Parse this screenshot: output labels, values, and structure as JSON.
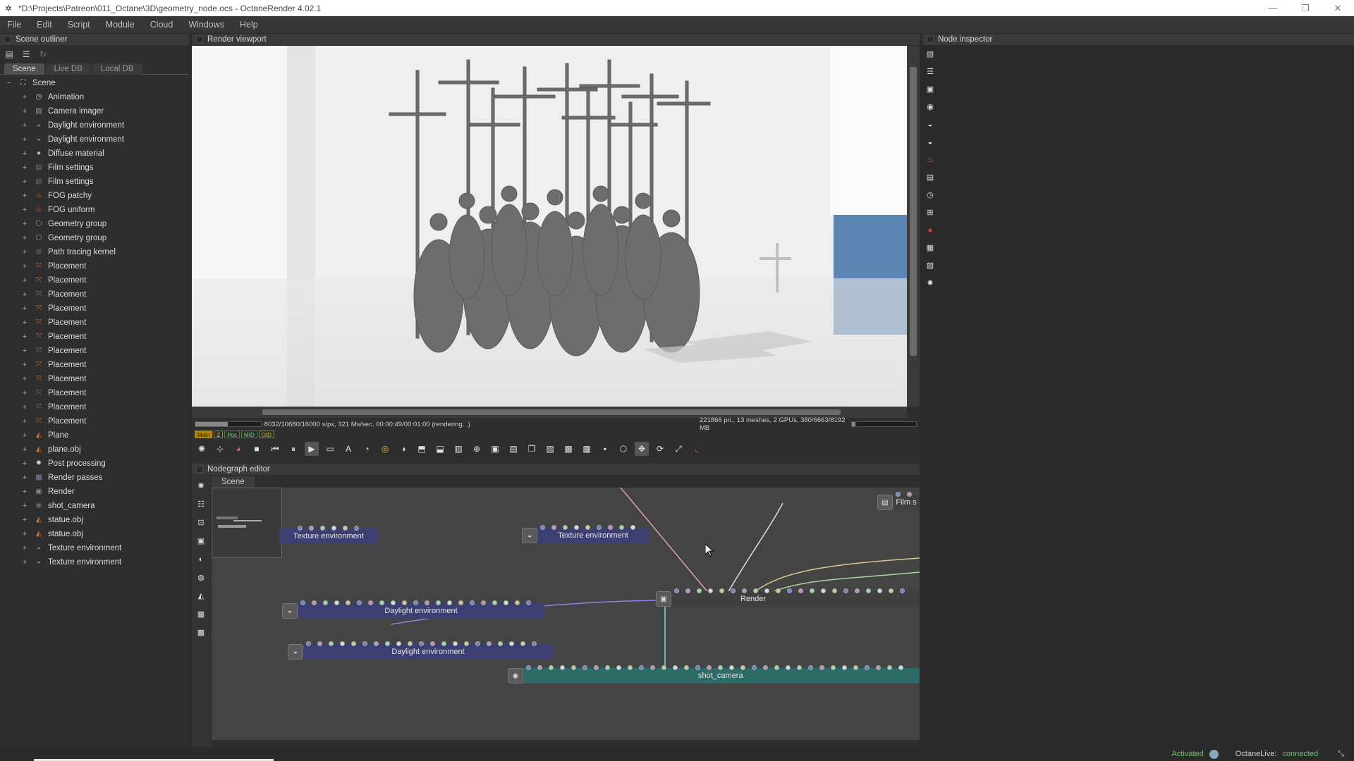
{
  "window": {
    "title": "*D:\\Projects\\Patreon\\011_Octane\\3D\\geometry_node.ocs - OctaneRender 4.02.1",
    "minimize": "—",
    "restore": "❐",
    "close": "✕"
  },
  "menu": [
    "File",
    "Edit",
    "Script",
    "Module",
    "Cloud",
    "Windows",
    "Help"
  ],
  "outliner": {
    "header": "Scene outliner",
    "tabs": [
      "Scene",
      "Live DB",
      "Local DB"
    ],
    "root": "Scene",
    "items": [
      {
        "label": "Animation",
        "icon": "clock-icon",
        "color": "#cfcfcf"
      },
      {
        "label": "Camera imager",
        "icon": "imager-icon",
        "color": "#9a9a9a"
      },
      {
        "label": "Daylight environment",
        "icon": "environment-icon",
        "color": "#8a8a8a"
      },
      {
        "label": "Daylight environment",
        "icon": "environment-icon",
        "color": "#8a8a8a"
      },
      {
        "label": "Diffuse material",
        "icon": "material-sphere-icon",
        "color": "#bdbdbd"
      },
      {
        "label": "Film settings",
        "icon": "film-icon",
        "color": "#707070"
      },
      {
        "label": "Film settings",
        "icon": "film-icon",
        "color": "#707070"
      },
      {
        "label": "FOG patchy",
        "icon": "flame-icon",
        "color": "#e08a2a"
      },
      {
        "label": "FOG uniform",
        "icon": "flame-icon",
        "color": "#e08a2a"
      },
      {
        "label": "Geometry group",
        "icon": "geometry-icon",
        "color": "#9a9a9a"
      },
      {
        "label": "Geometry group",
        "icon": "geometry-icon",
        "color": "#9a9a9a"
      },
      {
        "label": "Path tracing kernel",
        "icon": "kernel-icon",
        "color": "#707070"
      },
      {
        "label": "Placement",
        "icon": "placement-icon",
        "color": "#d07a3a"
      },
      {
        "label": "Placement",
        "icon": "placement-icon",
        "color": "#d07a3a"
      },
      {
        "label": "Placement",
        "icon": "placement-icon",
        "color": "#d07a3a"
      },
      {
        "label": "Placement",
        "icon": "placement-icon",
        "color": "#d07a3a"
      },
      {
        "label": "Placement",
        "icon": "placement-icon",
        "color": "#d07a3a"
      },
      {
        "label": "Placement",
        "icon": "placement-icon",
        "color": "#d07a3a"
      },
      {
        "label": "Placement",
        "icon": "placement-icon",
        "color": "#d07a3a"
      },
      {
        "label": "Placement",
        "icon": "placement-icon",
        "color": "#d07a3a"
      },
      {
        "label": "Placement",
        "icon": "placement-icon",
        "color": "#d07a3a"
      },
      {
        "label": "Placement",
        "icon": "placement-icon",
        "color": "#d07a3a"
      },
      {
        "label": "Placement",
        "icon": "placement-icon",
        "color": "#d07a3a"
      },
      {
        "label": "Placement",
        "icon": "placement-icon",
        "color": "#d07a3a"
      },
      {
        "label": "Plane",
        "icon": "mesh-icon",
        "color": "#d07a3a"
      },
      {
        "label": "plane.obj",
        "icon": "mesh-icon",
        "color": "#d07a3a"
      },
      {
        "label": "Post processing",
        "icon": "post-processing-icon",
        "color": "#cfcfcf"
      },
      {
        "label": "Render passes",
        "icon": "render-passes-icon",
        "color": "#7a8aa8"
      },
      {
        "label": "Render",
        "icon": "render-target-icon",
        "color": "#8a8a8a"
      },
      {
        "label": "shot_camera",
        "icon": "camera-icon",
        "color": "#707070"
      },
      {
        "label": "statue.obj",
        "icon": "mesh-icon",
        "color": "#d07a3a"
      },
      {
        "label": "statue.obj",
        "icon": "mesh-icon",
        "color": "#d07a3a"
      },
      {
        "label": "Texture environment",
        "icon": "environment-icon",
        "color": "#8a8a8a"
      },
      {
        "label": "Texture environment",
        "icon": "environment-icon",
        "color": "#8a8a8a"
      }
    ]
  },
  "viewport": {
    "header": "Render viewport",
    "progress_fraction": 0.5,
    "stats": "8032/10680/16000 s/px, 321 Ms/sec, 00:00:49/00:01:00 (rendering...)",
    "gpu_stats": "221866 pri., 13 meshes, 2 GPUs, 380/6663/8192 MB",
    "memory_fraction": 0.05,
    "badges": [
      "Main",
      "Z",
      "Pos",
      "MID",
      "OID"
    ],
    "toolbar_icons": [
      "recenter-icon",
      "zoom-region-icon",
      "color-sphere-icon",
      "stop-icon",
      "rewind-icon",
      "pause-icon",
      "play-icon",
      "render-region-icon",
      "af-icon",
      "color-picker-icon",
      "focus-picker-icon",
      "white-balance-icon",
      "material-picker-icon",
      "object-picker-icon",
      "save-icon",
      "zoom-icon",
      "crop-icon",
      "lock-icon",
      "copy-icon",
      "clipboard-icon",
      "film-region-icon",
      "grid-icon",
      "pixel-icon",
      "cube-icon",
      "move-icon",
      "rotate-icon",
      "expand-icon",
      "axis-icon"
    ]
  },
  "nodegraph": {
    "header": "Nodegraph editor",
    "tab": "Scene",
    "nodes": {
      "tex1": "Texture environment",
      "tex2": "Texture environment",
      "day1": "Daylight environment",
      "day2": "Daylight environment",
      "render": "Render",
      "camera": "shot_camera",
      "film": "Film s"
    }
  },
  "inspector": {
    "header": "Node inspector",
    "icons": [
      "inspector-icon",
      "list-icon",
      "render-target-icon",
      "camera-icon",
      "environment-icon",
      "environment-icon",
      "flame-icon",
      "film-icon",
      "clock-icon",
      "kernel-icon",
      "material-sphere-icon",
      "render-passes-icon",
      "imager-icon",
      "post-processing-icon"
    ]
  },
  "status": {
    "activated": "Activated",
    "live_label": "OctaneLive:",
    "live_value": "connected"
  }
}
